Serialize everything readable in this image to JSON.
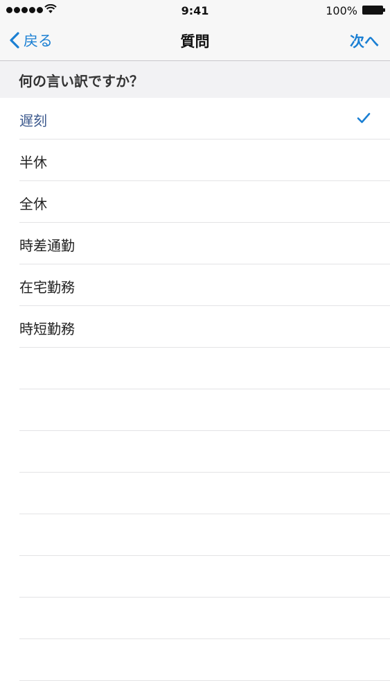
{
  "status_bar": {
    "time": "9:41",
    "battery_percent": "100%"
  },
  "nav": {
    "back_label": "戻る",
    "title": "質問",
    "next_label": "次へ"
  },
  "section": {
    "header": "何の言い訳ですか？"
  },
  "options": [
    {
      "label": "遅刻",
      "selected": true
    },
    {
      "label": "半休",
      "selected": false
    },
    {
      "label": "全休",
      "selected": false
    },
    {
      "label": "時差通勤",
      "selected": false
    },
    {
      "label": "在宅勤務",
      "selected": false
    },
    {
      "label": "時短勤務",
      "selected": false
    }
  ],
  "colors": {
    "accent": "#1a7fd3",
    "selected_text": "#3d5a8e"
  }
}
